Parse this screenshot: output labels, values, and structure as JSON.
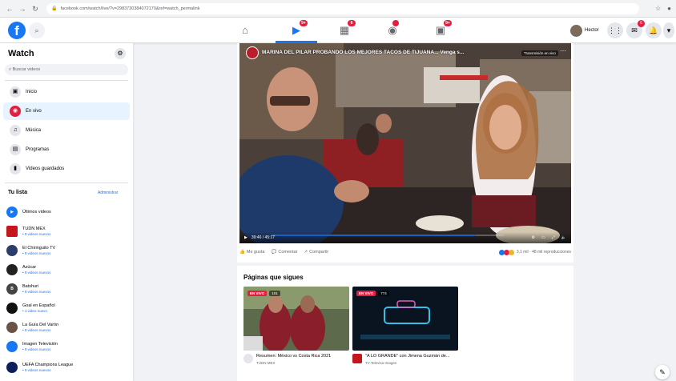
{
  "browser": {
    "url": "facebook.com/watch/live/?v=2983730384072170&ref=watch_permalink"
  },
  "header": {
    "user_name": "Hector",
    "nav_badges": [
      "9+",
      "6",
      "",
      "",
      "9+"
    ],
    "messenger_badge": "6",
    "notif_badge": ""
  },
  "sidebar": {
    "title": "Watch",
    "search_placeholder": "Buscar videos",
    "items": [
      {
        "label": "Inicio",
        "icon": "home-icon"
      },
      {
        "label": "En vivo",
        "icon": "live-icon"
      },
      {
        "label": "Música",
        "icon": "music-icon"
      },
      {
        "label": "Programas",
        "icon": "shows-icon"
      },
      {
        "label": "Videos guardados",
        "icon": "saved-icon"
      }
    ],
    "list_title": "Tu lista",
    "manage_label": "Administrar",
    "pages": [
      {
        "name": "Últimos videos",
        "sub": "",
        "color": "#1877f2"
      },
      {
        "name": "TUDN MEX",
        "sub": "• 9 videos nuevos",
        "color": "#c4161c"
      },
      {
        "name": "El Chiringuito TV",
        "sub": "• 9 videos nuevos",
        "color": "#2a3d6b"
      },
      {
        "name": "Azúcar",
        "sub": "• 9 videos nuevos",
        "color": "#222222"
      },
      {
        "name": "Batshuri",
        "sub": "• 9 videos nuevos",
        "color": "#444444"
      },
      {
        "name": "Goal en Español",
        "sub": "• 1 video nuevo",
        "color": "#111111"
      },
      {
        "name": "La Guía Del Varón",
        "sub": "• 9 videos nuevos",
        "color": "#6a5244"
      },
      {
        "name": "Imagen Televisión",
        "sub": "• 9 videos nuevos",
        "color": "#1877f2"
      },
      {
        "name": "UEFA Champions League",
        "sub": "• 9 videos nuevos",
        "color": "#0c1f5c"
      }
    ]
  },
  "video": {
    "title": "MARINA DEL PILAR PROBANDO LOS MEJORES TACOS DE TIJUANA... Venga s...",
    "live_label": "Transmisión en vivo",
    "time": "39:46 / 45:17",
    "progress": 0.88,
    "actions": [
      "Me gusta",
      "Comentar",
      "Compartir"
    ],
    "stats": "3,1 mil · 48 mil reproducciones"
  },
  "pages_section": {
    "title": "Páginas que sigues",
    "items": [
      {
        "badge": "EN VIVO",
        "viewers": "101",
        "caption": "Resumen: México vs Costa Rica 2021",
        "sub": "TUDN MEX"
      },
      {
        "badge": "EN VIVO",
        "viewers": "774",
        "caption": "\"A LO GRANDE\" con Jimena Guzmán de...",
        "sub": "TV Televisa Imagen"
      }
    ]
  }
}
